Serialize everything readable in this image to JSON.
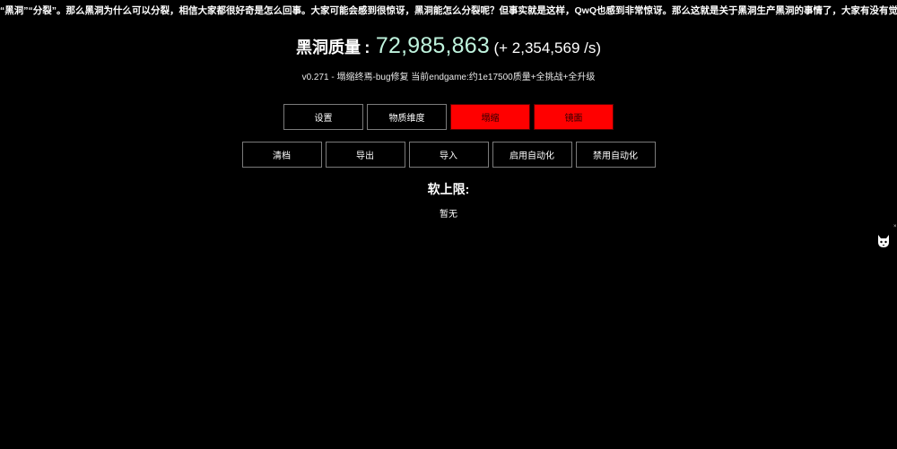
{
  "ticker": {
    "text": "“黑洞”“分裂”。那么黑洞为什么可以分裂，相信大家都很好奇是怎么回事。大家可能会感到很惊讶，黑洞能怎么分裂呢？但事实就是这样，QwQ也感到非常惊讶。那么这就是关于黑洞生产黑洞的事情了，大家有没有觉得很神奇呢？ - 辉影神秘"
  },
  "mass": {
    "label": "黑洞质量",
    "colon": ":",
    "value": "72,985,863",
    "rate": "(+ 2,354,569 /s)",
    "value_color": "#bff3dd"
  },
  "version": {
    "text": "v0.271 - 塌缩终焉-bug修复 当前endgame:约1e17500质量+全挑战+全升级"
  },
  "tabs": [
    {
      "label": "设置",
      "active": false
    },
    {
      "label": "物质维度",
      "active": false
    },
    {
      "label": "塌缩",
      "active": true
    },
    {
      "label": "镜面",
      "active": true
    }
  ],
  "actions": [
    {
      "label": "清档"
    },
    {
      "label": "导出"
    },
    {
      "label": "导入"
    },
    {
      "label": "启用自动化"
    },
    {
      "label": "禁用自动化"
    }
  ],
  "softcap": {
    "title": "软上限:",
    "none_text": "暂无"
  },
  "side": {
    "icon": "github-cat-icon",
    "mark": "×"
  },
  "colors": {
    "background": "#000000",
    "accent_red": "#ff0000",
    "button_border": "#7b7b7b"
  }
}
